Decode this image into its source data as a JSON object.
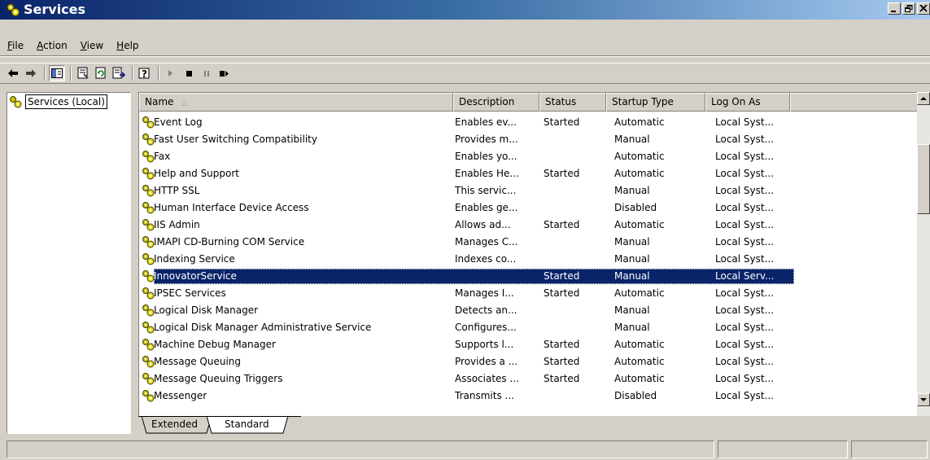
{
  "window": {
    "title": "Services",
    "icon": "services-gear-icon",
    "buttons": [
      "minimize-icon",
      "restore-icon",
      "close-icon"
    ]
  },
  "menubar": {
    "items": [
      {
        "label": "File",
        "underline": "F",
        "rest": "ile"
      },
      {
        "label": "Action",
        "underline": "A",
        "rest": "ction"
      },
      {
        "label": "View",
        "underline": "V",
        "rest": "iew"
      },
      {
        "label": "Help",
        "underline": "H",
        "rest": "elp"
      }
    ]
  },
  "toolbar": {
    "icons": [
      "back-icon",
      "forward-icon",
      "show-hide-tree-icon",
      "properties-icon",
      "refresh-icon",
      "export-list-icon",
      "help-icon",
      "start-service-icon",
      "stop-service-icon",
      "pause-service-icon",
      "restart-service-icon"
    ]
  },
  "tree": {
    "root_label": "Services (Local)"
  },
  "table": {
    "columns": [
      "Name",
      "Description",
      "Status",
      "Startup Type",
      "Log On As"
    ],
    "sort_column": "Name",
    "selected_row": "InnovatorService",
    "rows": [
      [
        "Event Log",
        "Enables ev...",
        "Started",
        "Automatic",
        "Local Syst..."
      ],
      [
        "Fast User Switching Compatibility",
        "Provides m...",
        "",
        "Manual",
        "Local Syst..."
      ],
      [
        "Fax",
        "Enables yo...",
        "",
        "Automatic",
        "Local Syst..."
      ],
      [
        "Help and Support",
        "Enables He...",
        "Started",
        "Automatic",
        "Local Syst..."
      ],
      [
        "HTTP SSL",
        "This servic...",
        "",
        "Manual",
        "Local Syst..."
      ],
      [
        "Human Interface Device Access",
        "Enables ge...",
        "",
        "Disabled",
        "Local Syst..."
      ],
      [
        "IIS Admin",
        "Allows ad...",
        "Started",
        "Automatic",
        "Local Syst..."
      ],
      [
        "IMAPI CD-Burning COM Service",
        "Manages C...",
        "",
        "Manual",
        "Local Syst..."
      ],
      [
        "Indexing Service",
        "Indexes co...",
        "",
        "Manual",
        "Local Syst..."
      ],
      [
        "InnovatorService",
        "",
        "Started",
        "Manual",
        "Local Serv..."
      ],
      [
        "IPSEC Services",
        "Manages I...",
        "Started",
        "Automatic",
        "Local Syst..."
      ],
      [
        "Logical Disk Manager",
        "Detects an...",
        "",
        "Manual",
        "Local Syst..."
      ],
      [
        "Logical Disk Manager Administrative Service",
        "Configures...",
        "",
        "Manual",
        "Local Syst..."
      ],
      [
        "Machine Debug Manager",
        "Supports l...",
        "Started",
        "Automatic",
        "Local Syst..."
      ],
      [
        "Message Queuing",
        "Provides a ...",
        "Started",
        "Automatic",
        "Local Syst..."
      ],
      [
        "Message Queuing Triggers",
        "Associates ...",
        "Started",
        "Automatic",
        "Local Syst..."
      ],
      [
        "Messenger",
        "Transmits ...",
        "",
        "Disabled",
        "Local Syst..."
      ]
    ]
  },
  "tabs": [
    {
      "label": "Extended",
      "active": false
    },
    {
      "label": "Standard",
      "active": true
    }
  ],
  "colors": {
    "selection": "#0a246a",
    "window_bg": "#d4d0c8",
    "title_gradient_start": "#0a246a",
    "title_gradient_end": "#a6caf0"
  }
}
